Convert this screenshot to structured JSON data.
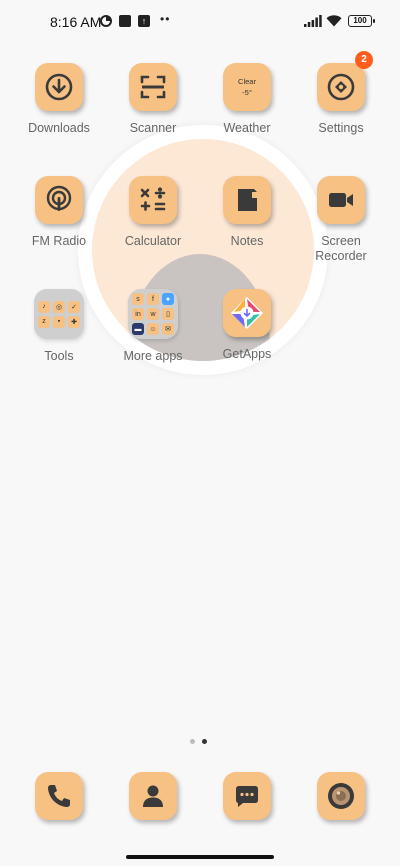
{
  "status": {
    "time": "8:16 AM",
    "dots": "••",
    "battery": "100"
  },
  "apps": [
    {
      "id": "downloads",
      "label": "Downloads",
      "icon": "download-icon"
    },
    {
      "id": "scanner",
      "label": "Scanner",
      "icon": "scanner-icon"
    },
    {
      "id": "weather",
      "label": "Weather",
      "icon": "weather-icon",
      "line1": "Clear",
      "line2": "-5°"
    },
    {
      "id": "settings",
      "label": "Settings",
      "icon": "settings-icon",
      "badge": "2"
    },
    {
      "id": "fm-radio",
      "label": "FM Radio",
      "icon": "radio-icon"
    },
    {
      "id": "calculator",
      "label": "Calculator",
      "icon": "calculator-icon"
    },
    {
      "id": "notes",
      "label": "Notes",
      "icon": "notes-icon"
    },
    {
      "id": "screen-recorder",
      "label": "Screen\nRecorder",
      "icon": "video-camera-icon"
    },
    {
      "id": "tools",
      "label": "Tools",
      "icon": "folder-icon"
    },
    {
      "id": "more-apps",
      "label": "More apps",
      "icon": "folder-icon"
    },
    {
      "id": "getapps",
      "label": "GetApps",
      "icon": "getapps-icon"
    }
  ],
  "labels": {
    "downloads": "Downloads",
    "scanner": "Scanner",
    "weather": "Weather",
    "weather_line1": "Clear",
    "weather_line2": "-5°",
    "settings": "Settings",
    "settings_badge": "2",
    "fm_radio": "FM Radio",
    "calculator": "Calculator",
    "notes": "Notes",
    "screen_recorder_1": "Screen",
    "screen_recorder_2": "Recorder",
    "tools": "Tools",
    "more_apps": "More apps",
    "getapps": "GetApps"
  },
  "pager": {
    "pages": 2,
    "current": 2
  },
  "dock": [
    "phone-icon",
    "contacts-icon",
    "messages-icon",
    "camera-icon"
  ],
  "colors": {
    "tile": "#f6c183",
    "badge": "#ff5e1f",
    "background": "#f8f8f8"
  }
}
